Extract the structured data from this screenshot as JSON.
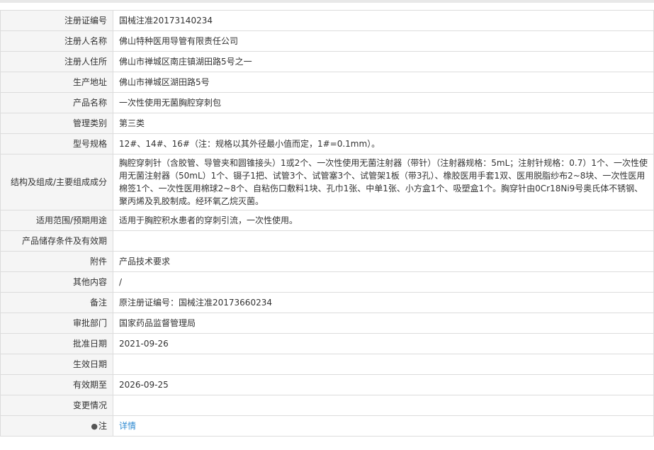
{
  "rows": [
    {
      "label": "注册证编号",
      "value": "国械注准20173140234"
    },
    {
      "label": "注册人名称",
      "value": "佛山特种医用导管有限责任公司"
    },
    {
      "label": "注册人住所",
      "value": "佛山市禅城区南庄镇湖田路5号之一"
    },
    {
      "label": "生产地址",
      "value": "佛山市禅城区湖田路5号"
    },
    {
      "label": "产品名称",
      "value": "一次性使用无菌胸腔穿刺包"
    },
    {
      "label": "管理类别",
      "value": "第三类"
    },
    {
      "label": "型号规格",
      "value": "12#、14#、16#（注：规格以其外径最小值而定，1#=0.1mm）。"
    },
    {
      "label": "结构及组成/主要组成成分",
      "value": "胸腔穿刺针（含胶管、导管夹和圆锥接头）1或2个、一次性使用无菌注射器（带针）（注射器规格：5mL；注射针规格：0.7）1个、一次性使用无菌注射器（50mL）1个、镊子1把、试管3个、试管塞3个、试管架1板（带3孔）、橡胶医用手套1双、医用脱脂纱布2~8块、一次性医用棉签1个、一次性医用棉球2~8个、自粘伤口敷料1块、孔巾1张、中单1张、小方盒1个、吸塑盒1个。胸穿针由0Cr18Ni9号奥氏体不锈钢、聚丙烯及乳胶制成。经环氧乙烷灭菌。"
    },
    {
      "label": "适用范围/预期用途",
      "value": "适用于胸腔积水患者的穿刺引流，一次性使用。"
    },
    {
      "label": "产品储存条件及有效期",
      "value": ""
    },
    {
      "label": "附件",
      "value": "产品技术要求"
    },
    {
      "label": "其他内容",
      "value": "/"
    },
    {
      "label": "备注",
      "value": "原注册证编号：国械注准20173660234"
    },
    {
      "label": "审批部门",
      "value": "国家药品监督管理局"
    },
    {
      "label": "批准日期",
      "value": "2021-09-26"
    },
    {
      "label": "生效日期",
      "value": ""
    },
    {
      "label": "有效期至",
      "value": "2026-09-25"
    },
    {
      "label": "变更情况",
      "value": ""
    }
  ],
  "note": {
    "icon": "●",
    "label": "注",
    "link_text": "详情"
  }
}
